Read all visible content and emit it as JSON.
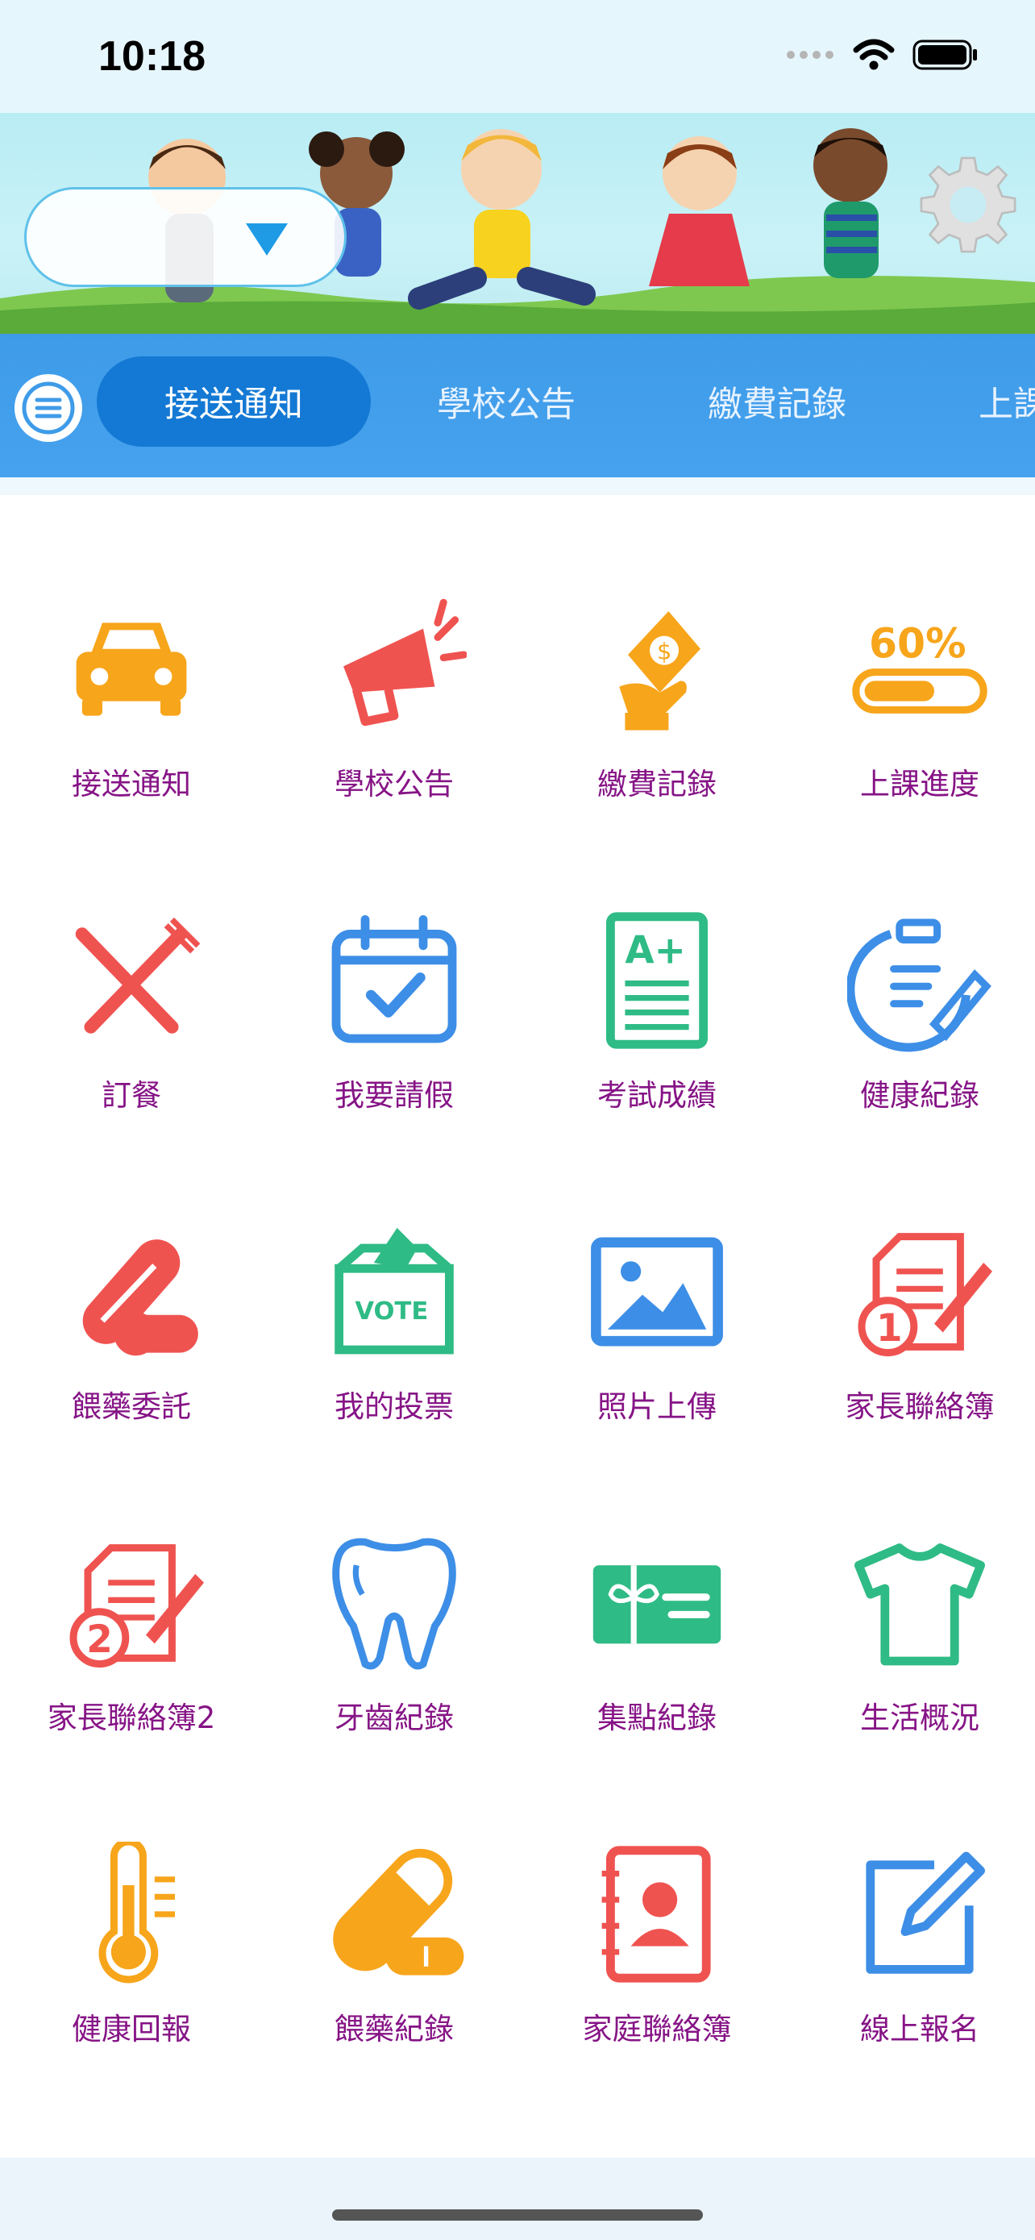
{
  "status_bar": {
    "time": "10:18",
    "icons": [
      "signal-icon",
      "wifi-icon",
      "battery-icon"
    ]
  },
  "header": {
    "account_selector_value": "",
    "settings_icon": "gear-icon",
    "menu_icon": "menu-icon"
  },
  "tabs": [
    {
      "label": "接送通知",
      "active": true
    },
    {
      "label": "學校公告",
      "active": false
    },
    {
      "label": "繳費記錄",
      "active": false
    },
    {
      "label": "上課進度",
      "active": false
    }
  ],
  "grid": {
    "items": [
      {
        "label": "接送通知",
        "icon": "car-icon",
        "color": "#f7a51b"
      },
      {
        "label": "學校公告",
        "icon": "megaphone-icon",
        "color": "#ef5350"
      },
      {
        "label": "繳費記錄",
        "icon": "payment-icon",
        "color": "#f7a51b"
      },
      {
        "label": "上課進度",
        "icon": "progress-icon",
        "color": "#f7a51b",
        "progress_text": "60%"
      },
      {
        "label": "訂餐",
        "icon": "fork-knife-icon",
        "color": "#ef5350"
      },
      {
        "label": "我要請假",
        "icon": "calendar-check-icon",
        "color": "#3d8ee6"
      },
      {
        "label": "考試成績",
        "icon": "grade-sheet-icon",
        "color": "#2fbb85",
        "grade_text": "A+"
      },
      {
        "label": "健康紀錄",
        "icon": "clipboard-pen-icon",
        "color": "#3d8ee6"
      },
      {
        "label": "餵藥委託",
        "icon": "pill-icon",
        "color": "#ef5350"
      },
      {
        "label": "我的投票",
        "icon": "ballot-box-icon",
        "color": "#2fbb85",
        "vote_text": "VOTE"
      },
      {
        "label": "照片上傳",
        "icon": "photo-icon",
        "color": "#3d8ee6"
      },
      {
        "label": "家長聯絡簿",
        "icon": "contact-book-1-icon",
        "color": "#ef5350",
        "badge": "1"
      },
      {
        "label": "家長聯絡簿2",
        "icon": "contact-book-2-icon",
        "color": "#ef5350",
        "badge": "2"
      },
      {
        "label": "牙齒紀錄",
        "icon": "tooth-icon",
        "color": "#3d8ee6"
      },
      {
        "label": "集點紀錄",
        "icon": "gift-card-icon",
        "color": "#2fbb85"
      },
      {
        "label": "生活概況",
        "icon": "tshirt-icon",
        "color": "#2fbb85"
      },
      {
        "label": "健康回報",
        "icon": "thermometer-icon",
        "color": "#f7a51b"
      },
      {
        "label": "餵藥紀錄",
        "icon": "capsule-icon",
        "color": "#f7a51b"
      },
      {
        "label": "家庭聯絡簿",
        "icon": "address-book-icon",
        "color": "#ef5350"
      },
      {
        "label": "線上報名",
        "icon": "edit-form-icon",
        "color": "#3d8ee6"
      }
    ]
  },
  "colors": {
    "tab_bar": "#3e9be8",
    "tab_active": "#1479d4",
    "label": "#861486"
  }
}
